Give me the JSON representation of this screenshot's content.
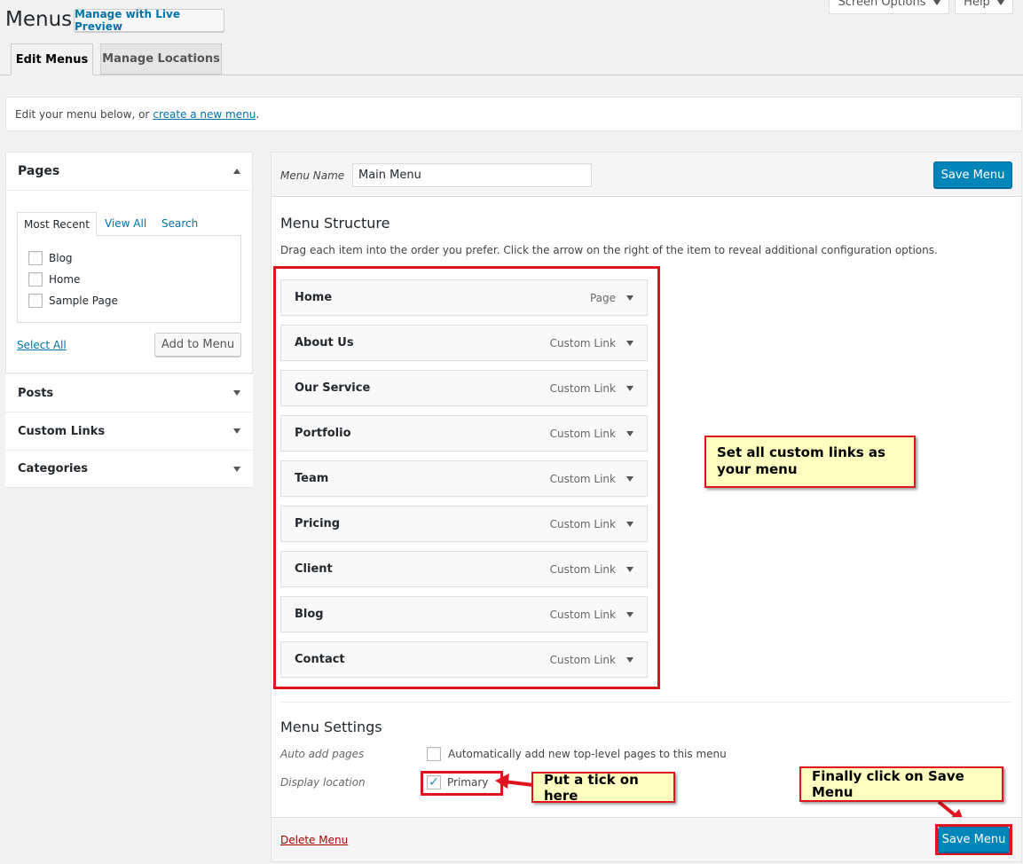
{
  "header": {
    "title": "Menus",
    "live_preview": "Manage with Live Preview",
    "screen_options": "Screen Options",
    "help": "Help"
  },
  "tabs": [
    {
      "label": "Edit Menus"
    },
    {
      "label": "Manage Locations"
    }
  ],
  "notice": {
    "prefix": "Edit your menu below, or ",
    "link": "create a new menu",
    "suffix": "."
  },
  "sidebar": {
    "pages": {
      "title": "Pages",
      "tabs": [
        "Most Recent",
        "View All",
        "Search"
      ],
      "items": [
        "Blog",
        "Home",
        "Sample Page"
      ],
      "select_all": "Select All",
      "add_button": "Add to Menu"
    },
    "sections": [
      "Posts",
      "Custom Links",
      "Categories"
    ]
  },
  "editor": {
    "menu_name_label": "Menu Name",
    "menu_name_value": "Main Menu",
    "save_button": "Save Menu",
    "structure_title": "Menu Structure",
    "structure_desc": "Drag each item into the order you prefer. Click the arrow on the right of the item to reveal additional configuration options.",
    "items": [
      {
        "title": "Home",
        "type": "Page"
      },
      {
        "title": "About Us",
        "type": "Custom Link"
      },
      {
        "title": "Our Service",
        "type": "Custom Link"
      },
      {
        "title": "Portfolio",
        "type": "Custom Link"
      },
      {
        "title": "Team",
        "type": "Custom Link"
      },
      {
        "title": "Pricing",
        "type": "Custom Link"
      },
      {
        "title": "Client",
        "type": "Custom Link"
      },
      {
        "title": "Blog",
        "type": "Custom Link"
      },
      {
        "title": "Contact",
        "type": "Custom Link"
      }
    ],
    "settings_title": "Menu Settings",
    "auto_add_label": "Auto add pages",
    "auto_add_text": "Automatically add new top-level pages to this menu",
    "display_location_label": "Display location",
    "primary_label": "Primary",
    "primary_checked": true,
    "delete_link": "Delete Menu"
  },
  "annotations": {
    "custom_links": "Set all custom links as your menu",
    "tick": "Put a tick on here",
    "save": "Finally click on Save Menu"
  },
  "colors": {
    "primary": "#0085ba",
    "annotation_border": "#e0141f",
    "annotation_bg": "#ffffc0",
    "delete": "#a00"
  }
}
